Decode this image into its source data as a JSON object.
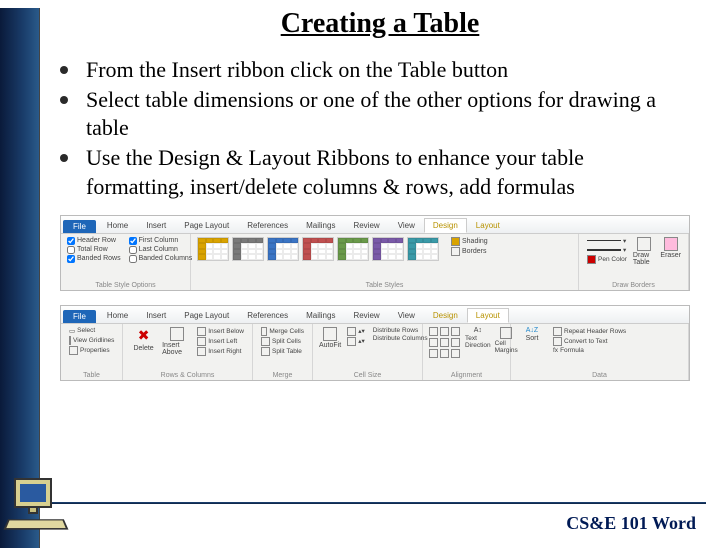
{
  "title": "Creating a Table",
  "bullets": [
    "From the Insert ribbon click on the Table button",
    "Select table dimensions or one of the other options for drawing a table",
    "Use the Design & Layout Ribbons to enhance your table formatting, insert/delete columns & rows, add formulas"
  ],
  "ribbon1": {
    "file": "File",
    "tabs": [
      "Home",
      "Insert",
      "Page Layout",
      "References",
      "Mailings",
      "Review",
      "View",
      "Design",
      "Layout"
    ],
    "active": "Design",
    "groups": {
      "style_options": {
        "label": "Table Style Options",
        "checks": [
          {
            "label": "Header Row",
            "checked": true
          },
          {
            "label": "First Column",
            "checked": true
          },
          {
            "label": "Total Row",
            "checked": false
          },
          {
            "label": "Last Column",
            "checked": false
          },
          {
            "label": "Banded Rows",
            "checked": true
          },
          {
            "label": "Banded Columns",
            "checked": false
          }
        ]
      },
      "table_styles": {
        "label": "Table Styles",
        "shading": "Shading",
        "borders": "Borders",
        "colors": [
          "#d9a300",
          "#7a7a7a",
          "#3a74c4",
          "#c05050",
          "#6a9a4a",
          "#7a5aa8",
          "#3a9aa8"
        ]
      },
      "draw_borders": {
        "label": "Draw Borders",
        "pen_color": "Pen Color",
        "draw": "Draw Table",
        "eraser": "Eraser"
      }
    }
  },
  "ribbon2": {
    "file": "File",
    "tabs": [
      "Home",
      "Insert",
      "Page Layout",
      "References",
      "Mailings",
      "Review",
      "View",
      "Design",
      "Layout"
    ],
    "active": "Layout",
    "groups": {
      "table": {
        "label": "Table",
        "select": "Select",
        "gridlines": "View Gridlines",
        "properties": "Properties"
      },
      "rows_cols": {
        "label": "Rows & Columns",
        "delete": "Delete",
        "above": "Insert Above",
        "below": "Insert Below",
        "left": "Insert Left",
        "right": "Insert Right"
      },
      "merge": {
        "label": "Merge",
        "merge": "Merge Cells",
        "split": "Split Cells",
        "split_table": "Split Table"
      },
      "cell_size": {
        "label": "Cell Size",
        "autofit": "AutoFit",
        "dist_rows": "Distribute Rows",
        "dist_cols": "Distribute Columns"
      },
      "alignment": {
        "label": "Alignment",
        "direction": "Text Direction",
        "margins": "Cell Margins"
      },
      "data": {
        "label": "Data",
        "sort": "Sort",
        "repeat": "Repeat Header Rows",
        "convert": "Convert to Text",
        "formula": "Formula"
      }
    }
  },
  "footer": "CS&E 101  Word"
}
